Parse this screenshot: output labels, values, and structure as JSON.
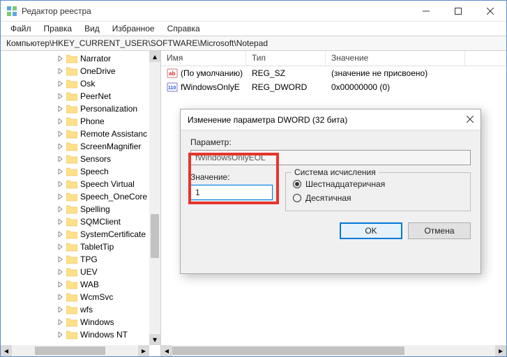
{
  "window": {
    "title": "Редактор реестра"
  },
  "menubar": [
    "Файл",
    "Правка",
    "Вид",
    "Избранное",
    "Справка"
  ],
  "path": "Компьютер\\HKEY_CURRENT_USER\\SOFTWARE\\Microsoft\\Notepad",
  "tree": {
    "items": [
      "Narrator",
      "OneDrive",
      "Osk",
      "PeerNet",
      "Personalization",
      "Phone",
      "Remote Assistanc",
      "ScreenMagnifier",
      "Sensors",
      "Speech",
      "Speech Virtual",
      "Speech_OneCore",
      "Spelling",
      "SQMClient",
      "SystemCertificate",
      "TabletTip",
      "TPG",
      "UEV",
      "WAB",
      "WcmSvc",
      "wfs",
      "Windows",
      "Windows NT"
    ]
  },
  "list": {
    "columns": {
      "name": "Имя",
      "type": "Тип",
      "value": "Значение"
    },
    "rows": [
      {
        "icon": "str",
        "name": "(По умолчанию)",
        "type": "REG_SZ",
        "value": "(значение не присвоено)"
      },
      {
        "icon": "num",
        "name": "fWindowsOnlyE",
        "type": "REG_DWORD",
        "value": "0x00000000 (0)"
      }
    ]
  },
  "dialog": {
    "title": "Изменение параметра DWORD (32 бита)",
    "labels": {
      "param": "Параметр:",
      "value": "Значение:"
    },
    "param_value": "fWindowsOnlyEOL",
    "value_value": "1",
    "group_title": "Система исчисления",
    "radio_hex": "Шестнадцатеричная",
    "radio_dec": "Десятичная",
    "ok": "OK",
    "cancel": "Отмена"
  },
  "col_widths": {
    "name": 122,
    "type": 114,
    "value": 200
  }
}
